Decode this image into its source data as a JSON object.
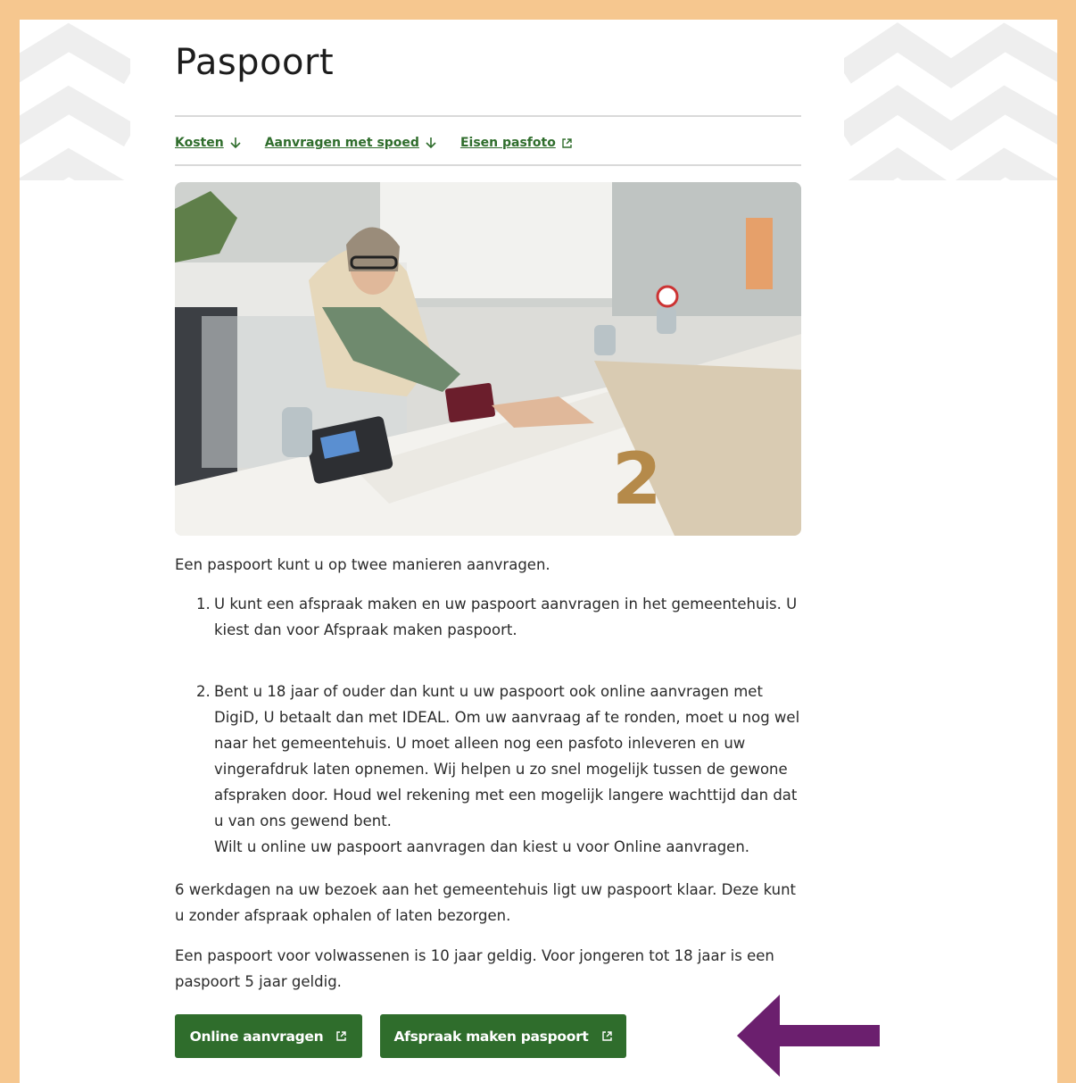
{
  "page": {
    "title": "Paspoort",
    "anchors": [
      {
        "label": "Kosten",
        "icon": "arrow-down-icon"
      },
      {
        "label": "Aanvragen met spoed",
        "icon": "arrow-down-icon"
      },
      {
        "label": "Eisen pasfoto",
        "icon": "external-link-icon"
      }
    ],
    "intro": "Een paspoort kunt u op twee manieren aanvragen.",
    "list": [
      {
        "num": "1.",
        "text": "U kunt een afspraak maken en uw paspoort aanvragen in het gemeentehuis. U kiest dan voor Afspraak maken paspoort."
      },
      {
        "num": "2.",
        "text": "Bent u 18 jaar of ouder dan kunt u uw paspoort ook online aanvragen met DigiD, U betaalt dan met IDEAL. Om uw aanvraag af te ronden, moet u nog wel naar het gemeentehuis. U moet alleen nog een pasfoto inleveren en uw vingerafdruk laten opnemen. Wij helpen u zo snel mogelijk tussen de gewone afspraken door. Houd wel rekening met een mogelijk langere wachttijd dan dat u van ons gewend bent.",
        "extra": "Wilt u online uw paspoort aanvragen dan kiest u voor Online aanvragen."
      }
    ],
    "para2": "6 werkdagen na uw bezoek aan het gemeentehuis ligt uw paspoort klaar. Deze kunt u zonder afspraak ophalen of laten bezorgen.",
    "para3": "Een paspoort voor volwassenen is 10 jaar geldig. Voor jongeren tot 18 jaar is een paspoort 5 jaar geldig.",
    "buttons": {
      "online": "Online aanvragen",
      "afspraak": "Afspraak maken paspoort"
    }
  },
  "colors": {
    "frame": "#f6c78f",
    "brand_green": "#2f6d2c",
    "annotation_arrow": "#6b1f6e"
  }
}
